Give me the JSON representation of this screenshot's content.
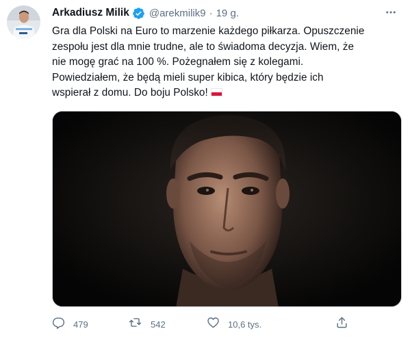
{
  "tweet": {
    "author_name": "Arkadiusz Milik",
    "handle": "@arekmilik9",
    "separator": "·",
    "time": "19 g.",
    "text_lines": [
      "Gra dla Polski na Euro to marzenie każdego piłkarza. Opuszczenie",
      "zespołu jest dla mnie trudne, ale to świadoma decyzja. Wiem, że",
      "nie mogę grać na 100 %. Pożegnałem się z kolegami.",
      "Powiedziałem, że będą mieli super kibica, który będzie ich",
      "wspierał z domu. Do boju Polsko!"
    ],
    "emoji": "flag-poland"
  },
  "icons": {
    "verified": "verified-badge-icon",
    "more": "more-icon",
    "reply": "reply-icon",
    "retweet": "retweet-icon",
    "like": "like-icon",
    "share": "share-icon"
  },
  "actions": {
    "replies": "479",
    "retweets": "542",
    "likes": "10,6 tys."
  },
  "colors": {
    "verified_blue": "#1da1f2",
    "secondary_text": "#5b7083",
    "primary_text": "#0f1419",
    "flag_red": "#dc143c"
  }
}
